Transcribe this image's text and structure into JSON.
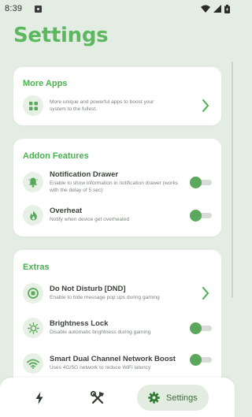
{
  "status_bar": {
    "time": "8:39"
  },
  "header": {
    "title": "Settings"
  },
  "more_apps": {
    "title": "More Apps",
    "subtitle": "More unique and powerful apps to boost your system to the fullest."
  },
  "addon": {
    "title": "Addon Features",
    "items": [
      {
        "title": "Notification Drawer",
        "subtitle": "Enable to show information in notification drawer (works with the delay of 5 sec)",
        "icon": "bell-icon",
        "enabled": true
      },
      {
        "title": "Overheat",
        "subtitle": "Notify when device get overheated",
        "icon": "flame-icon",
        "enabled": true
      }
    ]
  },
  "extras": {
    "title": "Extras",
    "items": [
      {
        "title": "Do Not Disturb [DND]",
        "subtitle": "Enable to hide message pop ups during gaming",
        "icon": "dnd-icon"
      },
      {
        "title": "Brightness Lock",
        "subtitle": "Disable automatic brightness during gaming",
        "icon": "brightness-icon",
        "enabled": true
      },
      {
        "title": "Smart Dual Channel Network Boost",
        "subtitle": "Uses 4G/5G network to reduce WiFi latency",
        "icon": "wifi-icon",
        "enabled": true
      }
    ]
  },
  "bottom_nav": {
    "items": [
      {
        "icon": "lightning-icon"
      },
      {
        "icon": "tools-icon"
      },
      {
        "icon": "gear-icon",
        "label": "Settings",
        "active": true
      }
    ]
  },
  "colors": {
    "accent": "#5cb85f",
    "background": "#e4ede3",
    "toggle_on": "#5aa85b"
  }
}
